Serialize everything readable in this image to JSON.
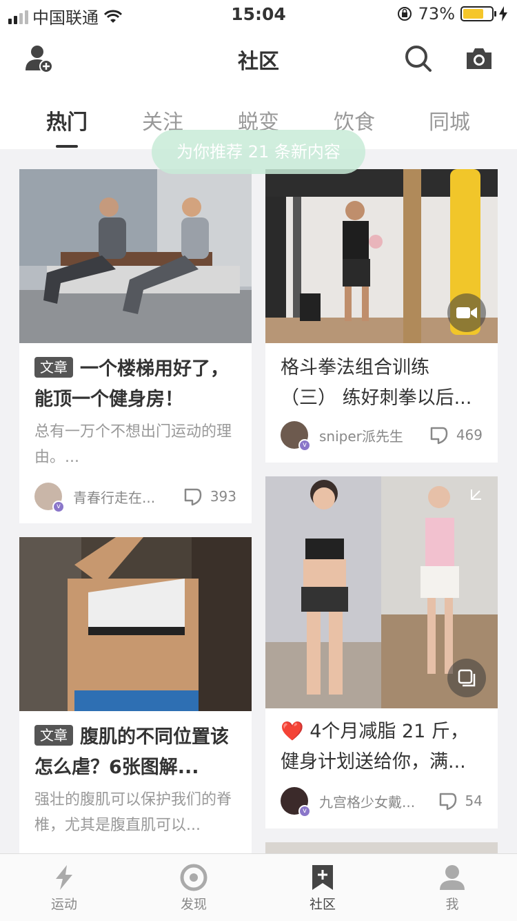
{
  "status": {
    "carrier": "中国联通",
    "time": "15:04",
    "battery": "73%",
    "battery_level": 0.73
  },
  "nav": {
    "title": "社区"
  },
  "tabs": [
    {
      "label": "热门",
      "active": true
    },
    {
      "label": "关注"
    },
    {
      "label": "蜕变"
    },
    {
      "label": "饮食"
    },
    {
      "label": "同城"
    }
  ],
  "toast": "为你推荐 21 条新内容",
  "cards": [
    {
      "tag": "文章",
      "title": "一个楼梯用好了，能顶一个健身房！",
      "desc": "总有一万个不想出门运动的理由。...",
      "author": "青春行走在...",
      "likes": "393"
    },
    {
      "title": "格斗拳法组合训练（三） 练好刺拳以后...",
      "author": "sniper派先生",
      "likes": "469",
      "media": "video-icon"
    },
    {
      "tag": "文章",
      "title": "腹肌的不同位置该怎么虐？6张图解...",
      "desc": "强壮的腹肌可以保护我们的脊椎，尤其是腹直肌可以...",
      "author": "",
      "likes": ""
    },
    {
      "title": "❤️ 4个月减脂 21 斤，健身计划送给你，满...",
      "author": "九宫格少女戴...",
      "likes": "54",
      "media": "gallery-icon"
    }
  ],
  "bottom": [
    {
      "label": "运动",
      "icon": "bolt-icon"
    },
    {
      "label": "发现",
      "icon": "discover-icon"
    },
    {
      "label": "社区",
      "icon": "community-icon",
      "active": true
    },
    {
      "label": "我",
      "icon": "profile-icon"
    }
  ]
}
